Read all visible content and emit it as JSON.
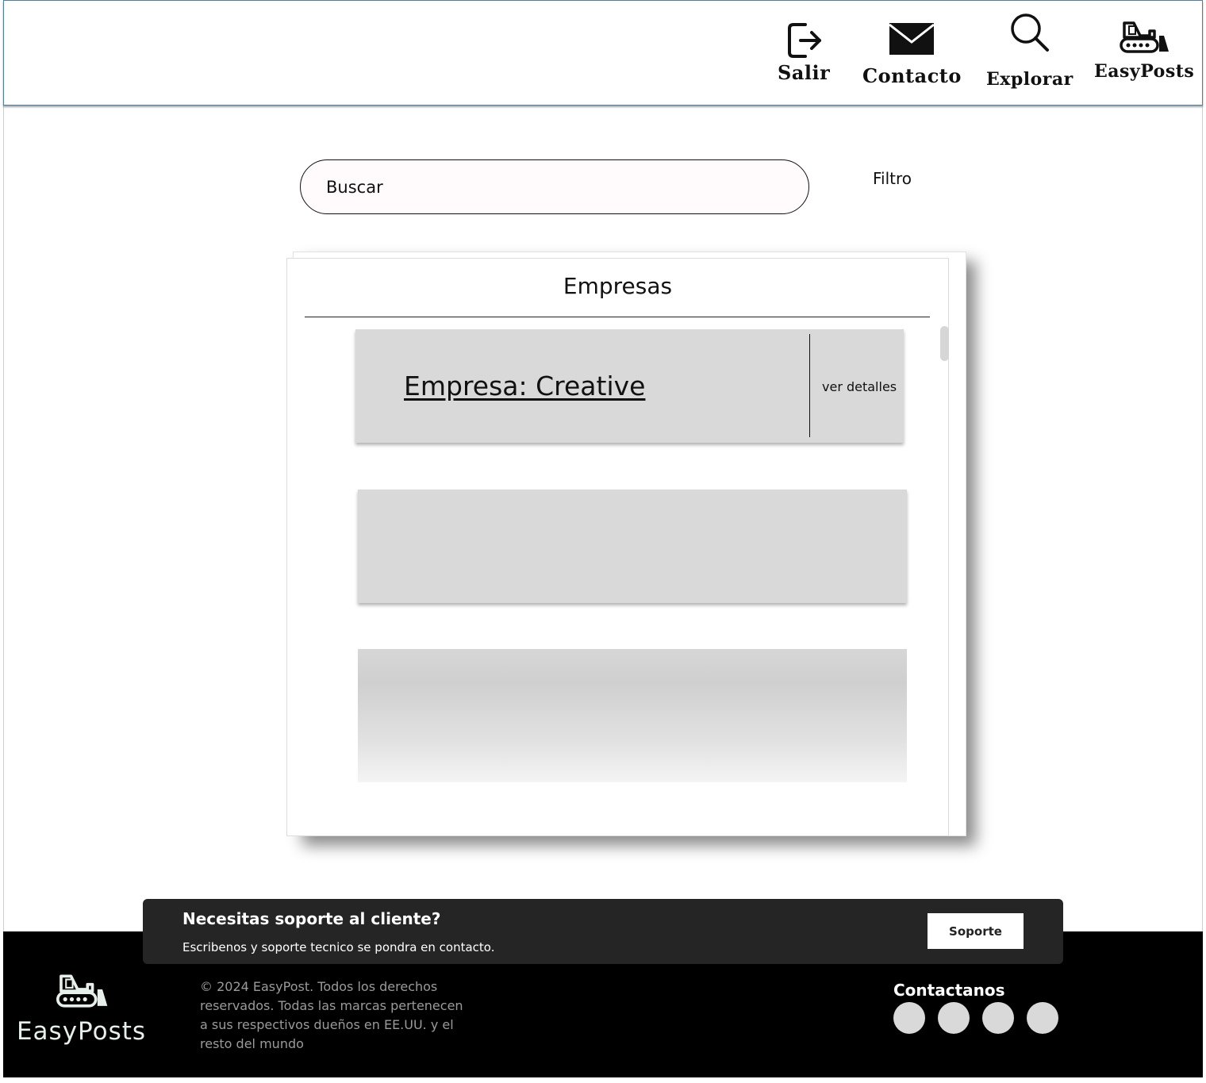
{
  "header": {
    "nav": [
      {
        "label": "Salir",
        "icon": "exit-icon"
      },
      {
        "label": "Contacto",
        "icon": "envelope-icon"
      },
      {
        "label": "Explorar",
        "icon": "search-icon"
      },
      {
        "label": "EasyPosts",
        "icon": "bulldozer-icon"
      }
    ]
  },
  "search": {
    "placeholder": "Buscar",
    "filter_label": "Filtro"
  },
  "panel": {
    "title": "Empresas",
    "cards": [
      {
        "title": "Empresa: Creative",
        "details_label": "ver detalles"
      }
    ]
  },
  "support": {
    "title": "Necesitas soporte al cliente?",
    "subtitle": "Escribenos y soporte tecnico se pondra en contacto.",
    "button_label": "Soporte"
  },
  "footer": {
    "brand": "EasyPosts",
    "logo_icon": "bulldozer-icon",
    "copyright": "© 2024 EasyPost. Todos los derechos reservados. Todas las marcas pertenecen a sus respectivos dueños en EE.UU. y el resto del mundo",
    "contact_title": "Contactanos",
    "social_icons": [
      "social-icon-1",
      "social-icon-2",
      "social-icon-3",
      "social-icon-4"
    ]
  },
  "colors": {
    "header_border": "#4f7fa3",
    "card_bg": "#d9d9d9",
    "footer_bg": "#000000",
    "support_bg": "#252525",
    "brand_text": "#e6efe9"
  }
}
